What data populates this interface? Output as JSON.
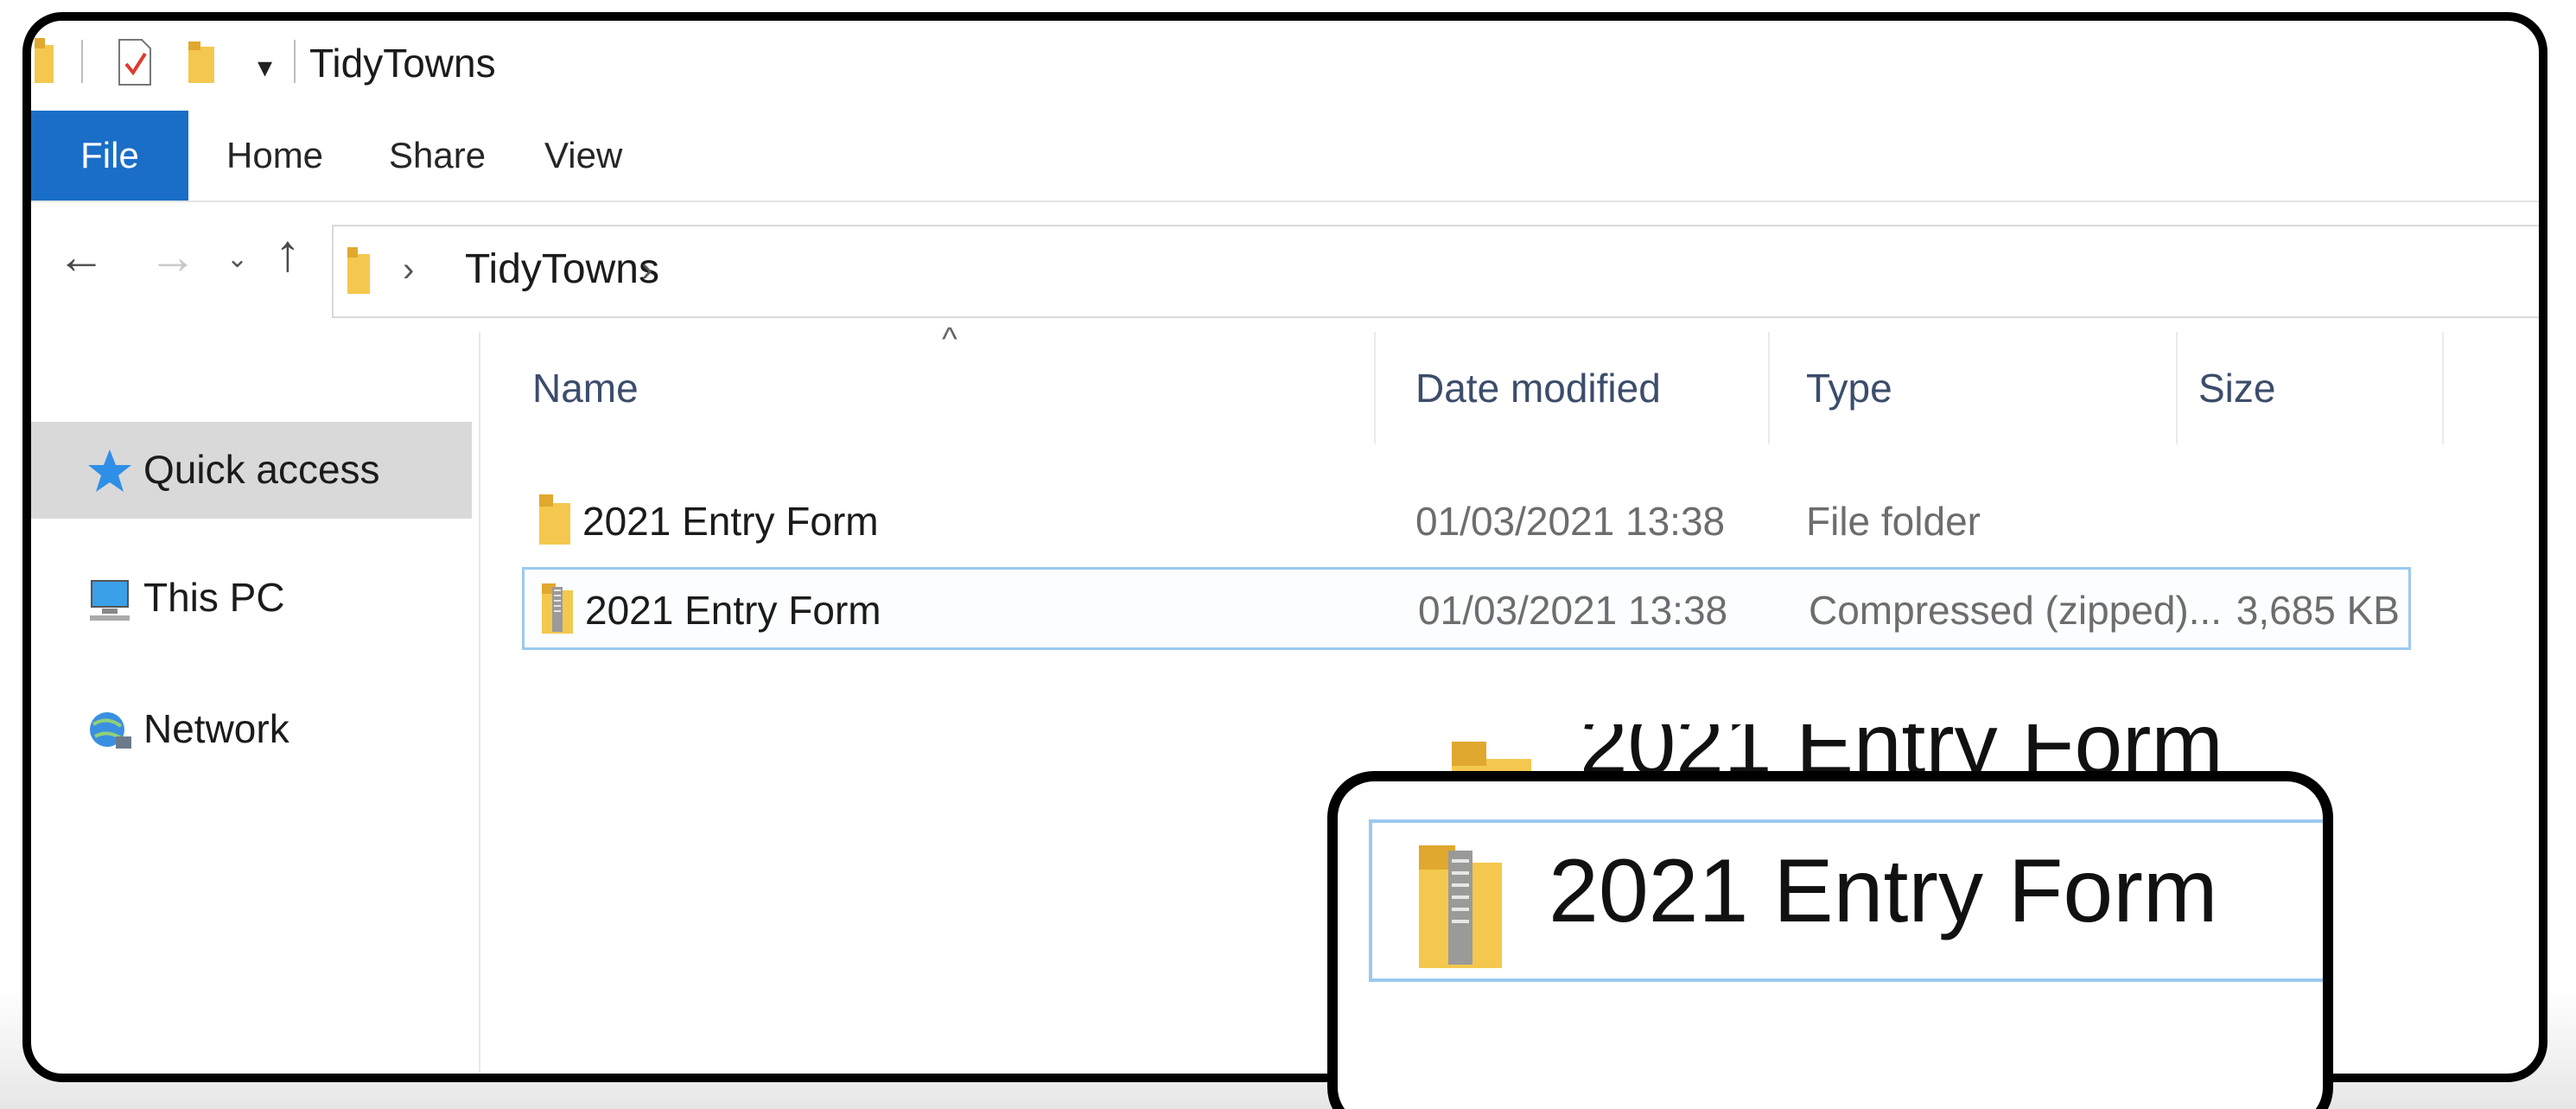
{
  "titlebar": {
    "title": "TidyTowns",
    "dropdown_glyph": "▾"
  },
  "ribbon": {
    "tabs": [
      "File",
      "Home",
      "Share",
      "View"
    ]
  },
  "nav": {
    "back_glyph": "←",
    "forward_glyph": "→",
    "recent_glyph": "⌄",
    "up_glyph": "↑",
    "chevron_glyph": "›",
    "path": "TidyTowns"
  },
  "sidebar": {
    "items": [
      {
        "label": "Quick access",
        "icon": "star-icon"
      },
      {
        "label": "This PC",
        "icon": "computer-icon"
      },
      {
        "label": "Network",
        "icon": "network-icon"
      }
    ]
  },
  "columns": {
    "sort_glyph": "^",
    "name": "Name",
    "date": "Date modified",
    "type": "Type",
    "size": "Size"
  },
  "files": [
    {
      "name": "2021 Entry Form",
      "date": "01/03/2021 13:38",
      "type": "File folder",
      "size": "",
      "icon": "folder-icon"
    },
    {
      "name": "2021 Entry Form",
      "date": "01/03/2021 13:38",
      "type": "Compressed (zipped)...",
      "size": "3,685 KB",
      "icon": "zip-folder-icon"
    }
  ],
  "zoom": {
    "partial_label": "2021 Entry Form",
    "label": "2021 Entry Form"
  },
  "colors": {
    "accent": "#1a6ec7",
    "selection_border": "#9cc9ef",
    "folder": "#f4c84e"
  }
}
